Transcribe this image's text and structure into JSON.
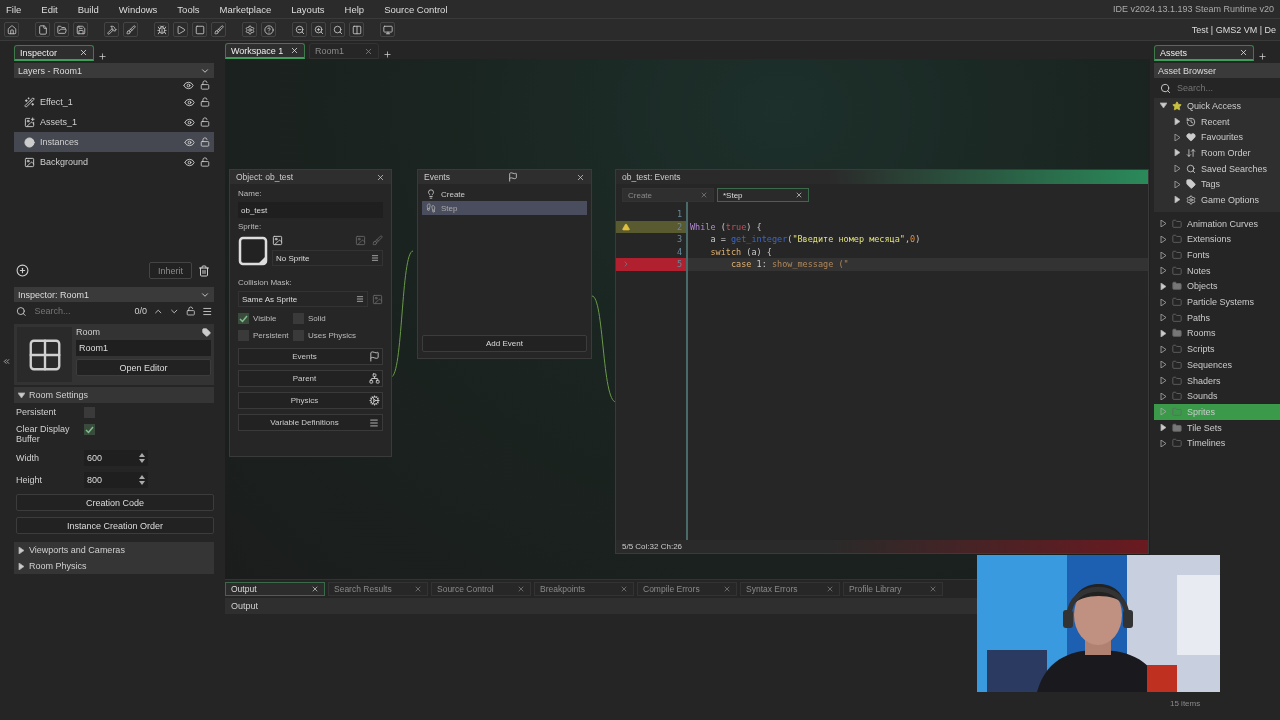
{
  "menu": [
    "File",
    "Edit",
    "Build",
    "Windows",
    "Tools",
    "Marketplace",
    "Layouts",
    "Help",
    "Source Control"
  ],
  "ide_version": "IDE v2024.13.1.193 Steam  Runtime v20",
  "target": "Test  |  GMS2 VM  |  De",
  "left": {
    "tabs": [
      {
        "label": "Inspector",
        "selected": true
      }
    ],
    "layers_dropdown": "Layers - Room1",
    "layers": [
      {
        "name": "Effect_1",
        "kind": "effect",
        "selected": false
      },
      {
        "name": "Assets_1",
        "kind": "assets",
        "selected": false
      },
      {
        "name": "Instances",
        "kind": "instances",
        "selected": true
      },
      {
        "name": "Background",
        "kind": "background",
        "selected": false
      }
    ],
    "inherit_button": {
      "label": "Inherit",
      "disabled": true
    },
    "inspector_dropdown": "Inspector: Room1",
    "search_placeholder": "Search...",
    "match_count": "0/0",
    "room": {
      "label": "Room",
      "name": "Room1",
      "open_editor": "Open Editor"
    },
    "room_settings": {
      "title": "Room Settings",
      "expanded": true,
      "checks": [
        {
          "label": "Persistent",
          "checked": false
        },
        {
          "label": "Clear Display Buffer",
          "checked": true
        }
      ],
      "fields": [
        {
          "label": "Width",
          "value": "600"
        },
        {
          "label": "Height",
          "value": "800"
        }
      ],
      "buttons": [
        "Creation Code",
        "Instance Creation Order"
      ]
    },
    "sections": [
      {
        "title": "Viewports and Cameras",
        "expanded": false
      },
      {
        "title": "Room Physics",
        "expanded": false
      }
    ]
  },
  "workspace_tabs": [
    {
      "label": "Workspace 1",
      "selected": true
    },
    {
      "label": "Room1",
      "selected": false
    }
  ],
  "object_window": {
    "title": "Object: ob_test",
    "name_label": "Name:",
    "name_value": "ob_test",
    "sprite_label": "Sprite:",
    "sprite_value": "No Sprite",
    "collision_label": "Collision Mask:",
    "collision_value": "Same As Sprite",
    "checkboxes": [
      {
        "label": "Visible",
        "checked": true
      },
      {
        "label": "Solid",
        "checked": false
      },
      {
        "label": "Persistent",
        "checked": false
      },
      {
        "label": "Uses Physics",
        "checked": false
      }
    ],
    "buttons": [
      {
        "label": "Events",
        "kind": "events"
      },
      {
        "label": "Parent",
        "kind": "parent"
      },
      {
        "label": "Physics",
        "kind": "physics"
      },
      {
        "label": "Variable Definitions",
        "kind": "variables"
      }
    ]
  },
  "events_window": {
    "title": "Events",
    "events": [
      {
        "label": "Create",
        "kind": "create",
        "selected": false
      },
      {
        "label": "Step",
        "kind": "step",
        "selected": true
      }
    ],
    "add_button": "Add Event"
  },
  "code_window": {
    "title": "ob_test: Events",
    "tabs": [
      {
        "label": "Create",
        "selected": false
      },
      {
        "label": "*Step",
        "selected": true
      }
    ],
    "lines": [
      {
        "number": "1",
        "warning": false,
        "error": false
      },
      {
        "number": "2",
        "warning": true,
        "error": false,
        "tokens": [
          {
            "text": "While",
            "kind": "keyword"
          },
          {
            "text": " (",
            "kind": "plain"
          },
          {
            "text": "true",
            "kind": "constant"
          },
          {
            "text": ") {",
            "kind": "plain"
          }
        ]
      },
      {
        "number": "3",
        "warning": false,
        "error": false,
        "tokens": [
          {
            "text": "    a = ",
            "kind": "plain"
          },
          {
            "text": "get_integer",
            "kind": "function"
          },
          {
            "text": "(",
            "kind": "plain"
          },
          {
            "text": "\"Введите номер месяца\"",
            "kind": "string"
          },
          {
            "text": ",",
            "kind": "plain"
          },
          {
            "text": "0",
            "kind": "number"
          },
          {
            "text": ")",
            "kind": "plain"
          }
        ]
      },
      {
        "number": "4",
        "warning": false,
        "error": false,
        "tokens": [
          {
            "text": "    switch",
            "kind": "keyword2"
          },
          {
            "text": " (a) {",
            "kind": "plain"
          }
        ]
      },
      {
        "number": "5",
        "warning": false,
        "error": true,
        "tokens": [
          {
            "text": "        case",
            "kind": "keyword2"
          },
          {
            "text": " 1: ",
            "kind": "plain"
          },
          {
            "text": "show_message",
            "kind": "faded"
          },
          {
            "text": " (\"",
            "kind": "faded"
          }
        ]
      }
    ],
    "status": "5/5 Col:32 Ch:26"
  },
  "assets": {
    "tabs": [
      {
        "label": "Assets",
        "selected": true
      }
    ],
    "header": "Asset Browser",
    "search_placeholder": "Search...",
    "quick_access": {
      "label": "Quick Access",
      "expanded": true,
      "children": [
        {
          "label": "Recent",
          "kind": "recent",
          "has_items": true
        },
        {
          "label": "Favourites",
          "kind": "favourites",
          "has_items": false
        },
        {
          "label": "Room Order",
          "kind": "order",
          "has_items": true
        },
        {
          "label": "Saved Searches",
          "kind": "search",
          "has_items": false
        },
        {
          "label": "Tags",
          "kind": "tags",
          "has_items": false
        },
        {
          "label": "Game Options",
          "kind": "options",
          "has_items": true
        }
      ]
    },
    "folders": [
      {
        "label": "Animation Curves",
        "has_items": false,
        "selected": false
      },
      {
        "label": "Extensions",
        "has_items": false,
        "selected": false
      },
      {
        "label": "Fonts",
        "has_items": false,
        "selected": false
      },
      {
        "label": "Notes",
        "has_items": false,
        "selected": false
      },
      {
        "label": "Objects",
        "has_items": true,
        "selected": false
      },
      {
        "label": "Particle Systems",
        "has_items": false,
        "selected": false
      },
      {
        "label": "Paths",
        "has_items": false,
        "selected": false
      },
      {
        "label": "Rooms",
        "has_items": true,
        "selected": false
      },
      {
        "label": "Scripts",
        "has_items": false,
        "selected": false
      },
      {
        "label": "Sequences",
        "has_items": false,
        "selected": false
      },
      {
        "label": "Shaders",
        "has_items": false,
        "selected": false
      },
      {
        "label": "Sounds",
        "has_items": false,
        "selected": false
      },
      {
        "label": "Sprites",
        "has_items": false,
        "selected": true
      },
      {
        "label": "Tile Sets",
        "has_items": true,
        "selected": false
      },
      {
        "label": "Timelines",
        "has_items": false,
        "selected": false
      }
    ],
    "footer": "15 items"
  },
  "output": {
    "tabs": [
      {
        "label": "Output",
        "selected": true
      },
      {
        "label": "Search Results",
        "selected": false
      },
      {
        "label": "Source Control",
        "selected": false
      },
      {
        "label": "Breakpoints",
        "selected": false
      },
      {
        "label": "Compile Errors",
        "selected": false
      },
      {
        "label": "Syntax Errors",
        "selected": false
      },
      {
        "label": "Profile Library",
        "selected": false
      }
    ],
    "title": "Output"
  }
}
